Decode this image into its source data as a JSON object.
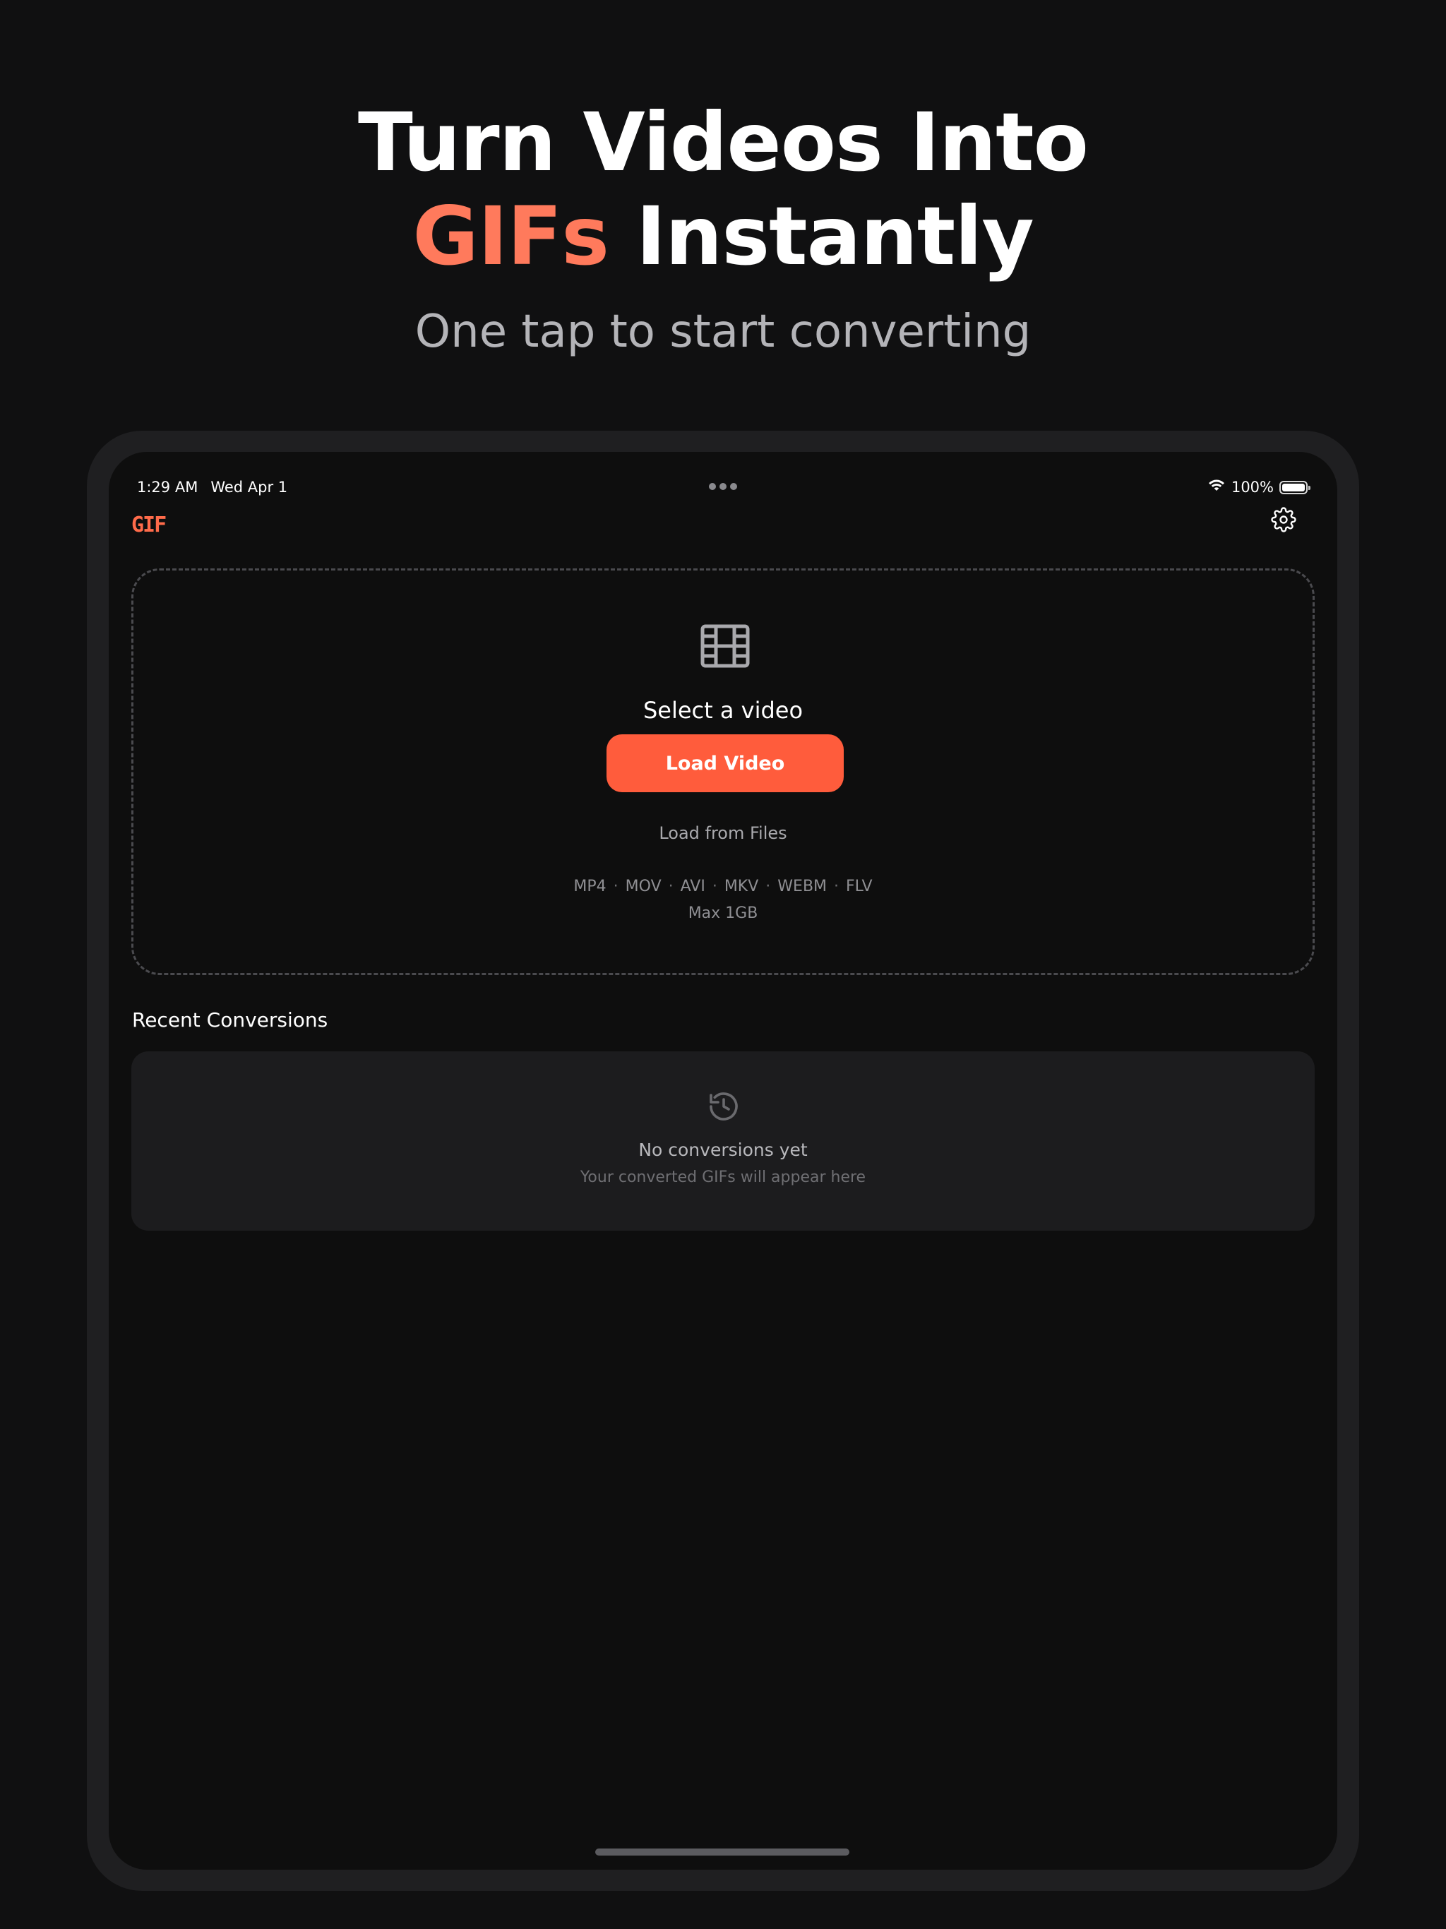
{
  "headline": {
    "line1": "Turn Videos Into",
    "line2_accent": "GIFs",
    "line2_rest": " Instantly",
    "accent_color": "#ff7a5c"
  },
  "subheadline": "One tap to start converting",
  "status_bar": {
    "time": "1:29 AM",
    "date": "Wed Apr 1",
    "battery": "100%",
    "wifi_icon": "wifi-icon",
    "battery_icon": "battery-icon"
  },
  "nav": {
    "logo_text": "GIF",
    "settings_icon": "gear-icon"
  },
  "dropzone": {
    "icon": "film-icon",
    "title": "Select a video",
    "load_button": "Load Video",
    "files_link": "Load from Files",
    "formats": [
      "MP4",
      "MOV",
      "AVI",
      "MKV",
      "WEBM",
      "FLV"
    ],
    "format_separator": "·",
    "max_size": "Max 1GB"
  },
  "recent": {
    "title": "Recent Conversions",
    "empty_icon": "history-icon",
    "empty_title": "No conversions yet",
    "empty_subtitle": "Your converted GIFs will appear here"
  },
  "colors": {
    "accent": "#ff5c3c",
    "background": "#0e0e0e",
    "card": "#1c1c1e"
  }
}
